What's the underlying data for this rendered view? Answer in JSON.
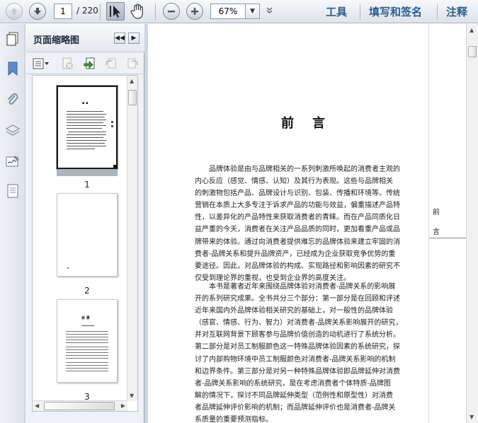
{
  "toolbar": {
    "current_page": "1",
    "total_pages": "/ 220",
    "zoom_value": "67%",
    "menu": [
      "工具",
      "填写和签名",
      "注释"
    ],
    "icons": [
      "up-arrow-icon",
      "down-arrow-icon",
      "select-cursor-icon",
      "hand-icon",
      "zoom-out-icon",
      "zoom-in-icon",
      "chevron-down-icon"
    ]
  },
  "left_strip": {
    "icons": [
      "bookmark-icon",
      "paperclip-icon",
      "layers-icon",
      "signature-icon",
      "page-icon"
    ]
  },
  "thumbnails": {
    "title": "页面缩略图",
    "tool_icons": [
      "options-menu-icon",
      "delete-page-icon",
      "insert-page-icon",
      "undo-icon",
      "redo-icon"
    ],
    "pages": [
      {
        "label": "1",
        "selected": true
      },
      {
        "label": "2",
        "selected": false
      },
      {
        "label": "3",
        "selected": false
      }
    ],
    "page1_heading": "▪ ▪",
    "page3_heading": "目 录"
  },
  "document": {
    "title": "前言",
    "running_head": "前言",
    "paragraph1": [
      "品牌体验是由与品牌相关的一系列刺激所唤起的消费者主观的",
      "内心反应（感觉、情感、认知）及其行为表现。这些与品牌相关",
      "的刺激物包括产品、品牌设计与识别、包装、传播和环境等。传统",
      "营销在本质上大多专注于诉求产品的功能与效益，偏重描述产品特",
      "性，以差异化的产品特性来获取消费者的青睐。而在产品同质化日",
      "益严重的今天，消费者在关注产品品质的同时，更加看重产品或品",
      "牌带来的体验。通过向消费者提供难忘的品牌体验来建立牢固的消",
      "费者-品牌关系和提升品牌资产，已经成为企业获取竞争优势的重",
      "要途径。因此，对品牌体验的构成、实现路径和影响因素的研究不",
      "仅受到理论界的重视，也受到企业界的高度关注。"
    ],
    "paragraph2": [
      "本书是著者近年来围绕品牌体验对消费者-品牌关系的影响展",
      "开的系列研究成果。全书共分三个部分：第一部分是在回顾和评述",
      "近年来国内外品牌体验相关研究的基础上，对一般性的品牌体验",
      "（感官、情感、行为、智力）对消费者-品牌关系影响展开的研究，",
      "并对互联网背景下顾客参与品牌价值创造的动机进行了系统分析。",
      "第二部分是对员工制服颜色这一特殊品牌体验因素的系统研究，探",
      "讨了内部购物环境中员工制服颜色对消费者-品牌关系影响的机制",
      "和边界条件。第三部分是对另一种特殊品牌体验即品牌延伸对消费",
      "者-品牌关系影响的系统研究，是在考虑消费者个体特质-品牌图",
      "解的情况下，探讨不同品牌延伸类型（范例性和原型性）对消费",
      "者品牌延伸评价影响的机制；而品牌延伸评价也是消费者-品牌关",
      "系质量的重要预测指标。"
    ]
  },
  "colors": {
    "menu_text": "#2b5d8e",
    "toolbar_bg": "#dde3ea",
    "panel_bg": "#eef1f5"
  }
}
